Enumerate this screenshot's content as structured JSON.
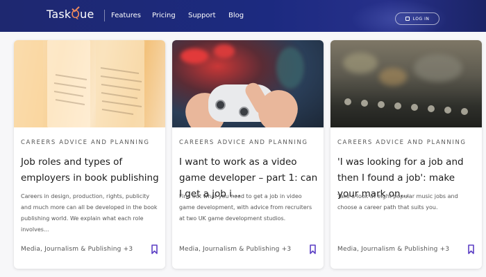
{
  "header": {
    "logo_text": "Task",
    "logo_highlight": "ue",
    "nav": [
      "Features",
      "Pricing",
      "Support",
      "Blog"
    ],
    "login_label": "LOG IN"
  },
  "cards": [
    {
      "category": "CAREERS ADVICE AND PLANNING",
      "title": "Job roles and types of employers in book publishing",
      "description": "Careers in design, production, rights, publicity and much more can all be developed in the book publishing world. We explain what each role involves...",
      "tags": "Media, Journalism & Publishing +3"
    },
    {
      "category": "CAREERS ADVICE AND PLANNING",
      "title": "I want to work as a video game developer – part 1: can I get a job i...",
      "description": "Find out what you need to get a job in video game development, with advice from recruiters at two UK game development studios.",
      "tags": "Media, Journalism & Publishing +3"
    },
    {
      "category": "CAREERS ADVICE AND PLANNING",
      "title": "'I was looking for a job and then I found a job': make your mark on...",
      "description": "Take a look at eight popular music jobs and choose a career path that suits you.",
      "tags": "Media, Journalism & Publishing +3"
    }
  ],
  "colors": {
    "header_bg": "#1e2870",
    "accent_orange": "#f08a5d",
    "bookmark": "#5b3fc4"
  }
}
